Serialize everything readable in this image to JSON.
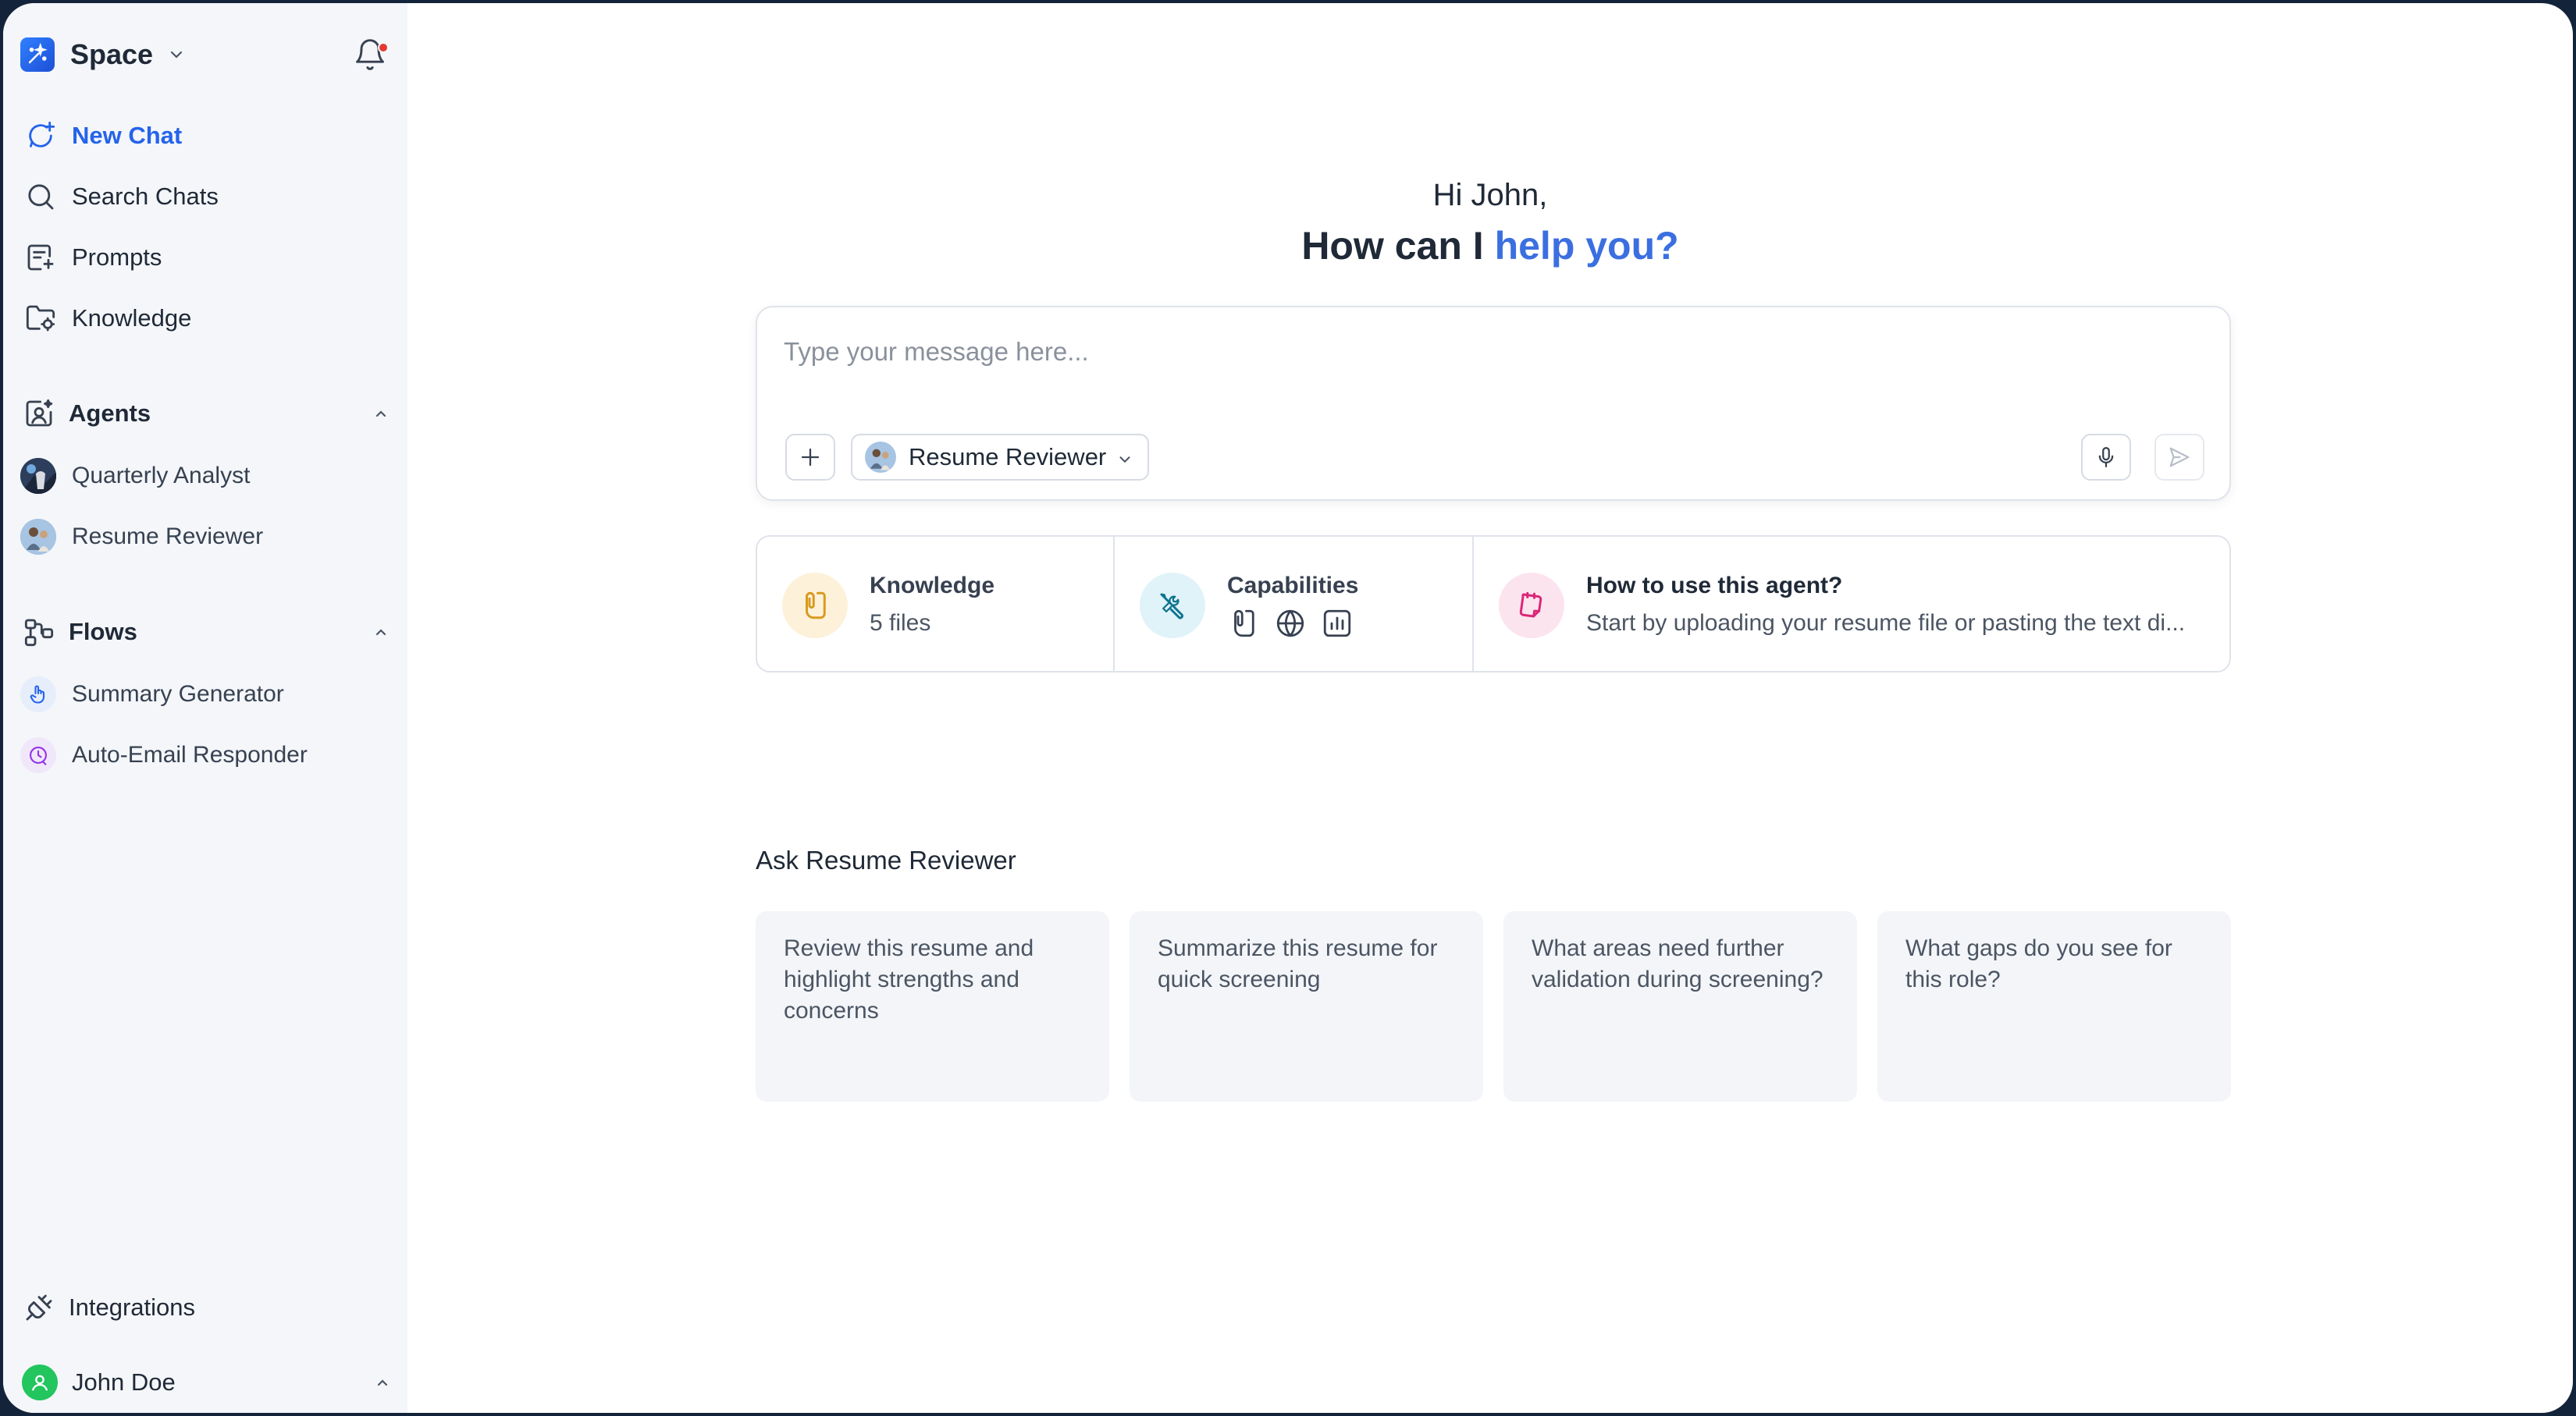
{
  "brand": {
    "name": "Space",
    "icon": "sparkle-logo-icon"
  },
  "notifications": {
    "icon": "bell-icon",
    "has_unread": true
  },
  "nav": [
    {
      "label": "New Chat",
      "icon": "new-chat-icon",
      "active": true
    },
    {
      "label": "Search Chats",
      "icon": "search-icon",
      "active": false
    },
    {
      "label": "Prompts",
      "icon": "prompts-icon",
      "active": false
    },
    {
      "label": "Knowledge",
      "icon": "knowledge-folder-icon",
      "active": false
    }
  ],
  "agents": {
    "title": "Agents",
    "items": [
      {
        "label": "Quarterly Analyst"
      },
      {
        "label": "Resume Reviewer"
      }
    ]
  },
  "flows": {
    "title": "Flows",
    "items": [
      {
        "label": "Summary Generator"
      },
      {
        "label": "Auto-Email Responder"
      }
    ]
  },
  "footer": {
    "integrations_label": "Integrations",
    "user_name": "John Doe"
  },
  "greeting": {
    "line1": "Hi John,",
    "line2_prefix": "How can I ",
    "line2_accent": "help you?"
  },
  "composer": {
    "placeholder": "Type your message here...",
    "selected_agent": "Resume Reviewer"
  },
  "info": {
    "knowledge": {
      "title": "Knowledge",
      "sub": "5 files"
    },
    "capabilities": {
      "title": "Capabilities",
      "icons": [
        "file-icon",
        "globe-icon",
        "chart-icon"
      ]
    },
    "how": {
      "title": "How to use this agent?",
      "sub": "Start by uploading your resume file or pasting the text di..."
    }
  },
  "ask": {
    "title": "Ask Resume Reviewer",
    "suggestions": [
      "Review this resume and highlight strengths and concerns",
      "Summarize this resume for quick screening",
      "What areas need further validation during screening?",
      "What gaps do you see for this role?"
    ]
  },
  "colors": {
    "accent": "#2563eb",
    "sidebar_bg": "#f4f6f9",
    "card_bg": "#f3f5f8"
  }
}
